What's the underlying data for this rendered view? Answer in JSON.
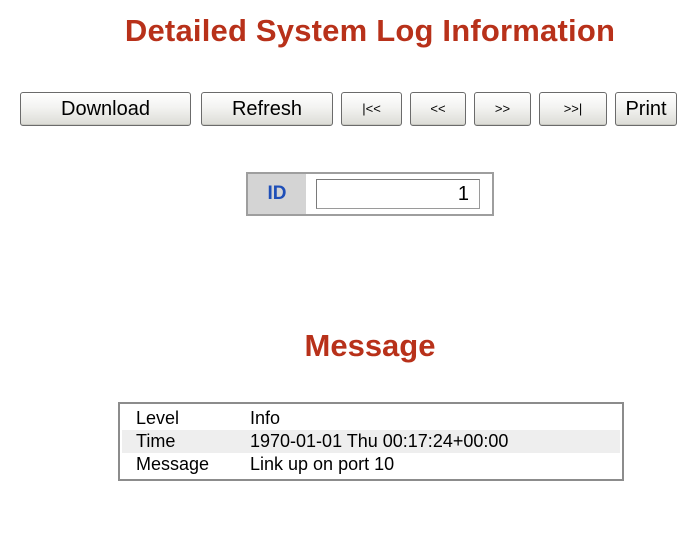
{
  "page": {
    "title": "Detailed System Log Information",
    "section_title": "Message"
  },
  "toolbar": {
    "download_label": "Download",
    "refresh_label": "Refresh",
    "first_label": "|<<",
    "prev_label": "<<",
    "next_label": ">>",
    "last_label": ">>|",
    "print_label": "Print"
  },
  "id_field": {
    "label": "ID",
    "value": "1"
  },
  "message_table": {
    "rows": [
      {
        "key": "Level",
        "value": "Info"
      },
      {
        "key": "Time",
        "value": "1970-01-01 Thu 00:17:24+00:00"
      },
      {
        "key": "Message",
        "value": "Link up on port 10"
      }
    ]
  },
  "colors": {
    "title": "#b8311a",
    "id_label_text": "#1f4fb8",
    "id_label_bg": "#d4d4d4",
    "alt_row_bg": "#eeeeee"
  }
}
